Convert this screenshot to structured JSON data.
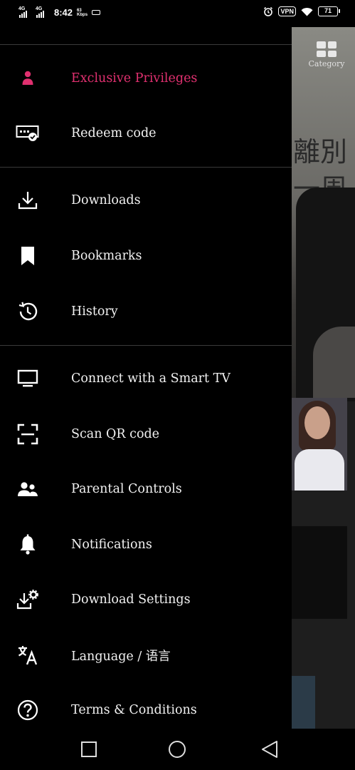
{
  "status_bar": {
    "network_1": "4G",
    "network_2": "4G",
    "time": "8:42",
    "speed_value": "63",
    "speed_unit": "Kbps",
    "vpn": "VPN",
    "battery": "71"
  },
  "background_app": {
    "category_label": "Category",
    "banner_text_1": "離別",
    "banner_text_2": "一周"
  },
  "drawer": {
    "items": [
      {
        "label": "Exclusive Privileges",
        "icon": "person-icon",
        "color": "#e0306f"
      },
      {
        "label": "Redeem code",
        "icon": "redeem-code-icon"
      },
      {
        "label": "Downloads",
        "icon": "download-icon"
      },
      {
        "label": "Bookmarks",
        "icon": "bookmark-icon"
      },
      {
        "label": "History",
        "icon": "history-icon"
      },
      {
        "label": "Connect with a Smart TV",
        "icon": "tv-icon"
      },
      {
        "label": "Scan QR code",
        "icon": "scan-icon"
      },
      {
        "label": "Parental Controls",
        "icon": "parental-icon"
      },
      {
        "label": "Notifications",
        "icon": "bell-icon"
      },
      {
        "label": "Download Settings",
        "icon": "download-settings-icon"
      },
      {
        "label": "Language / 语言",
        "icon": "language-icon"
      },
      {
        "label": "Terms & Conditions",
        "icon": "help-icon"
      }
    ]
  },
  "colors": {
    "accent": "#e0306f",
    "drawer_background": "#000000",
    "text": "#f2f2f2"
  }
}
